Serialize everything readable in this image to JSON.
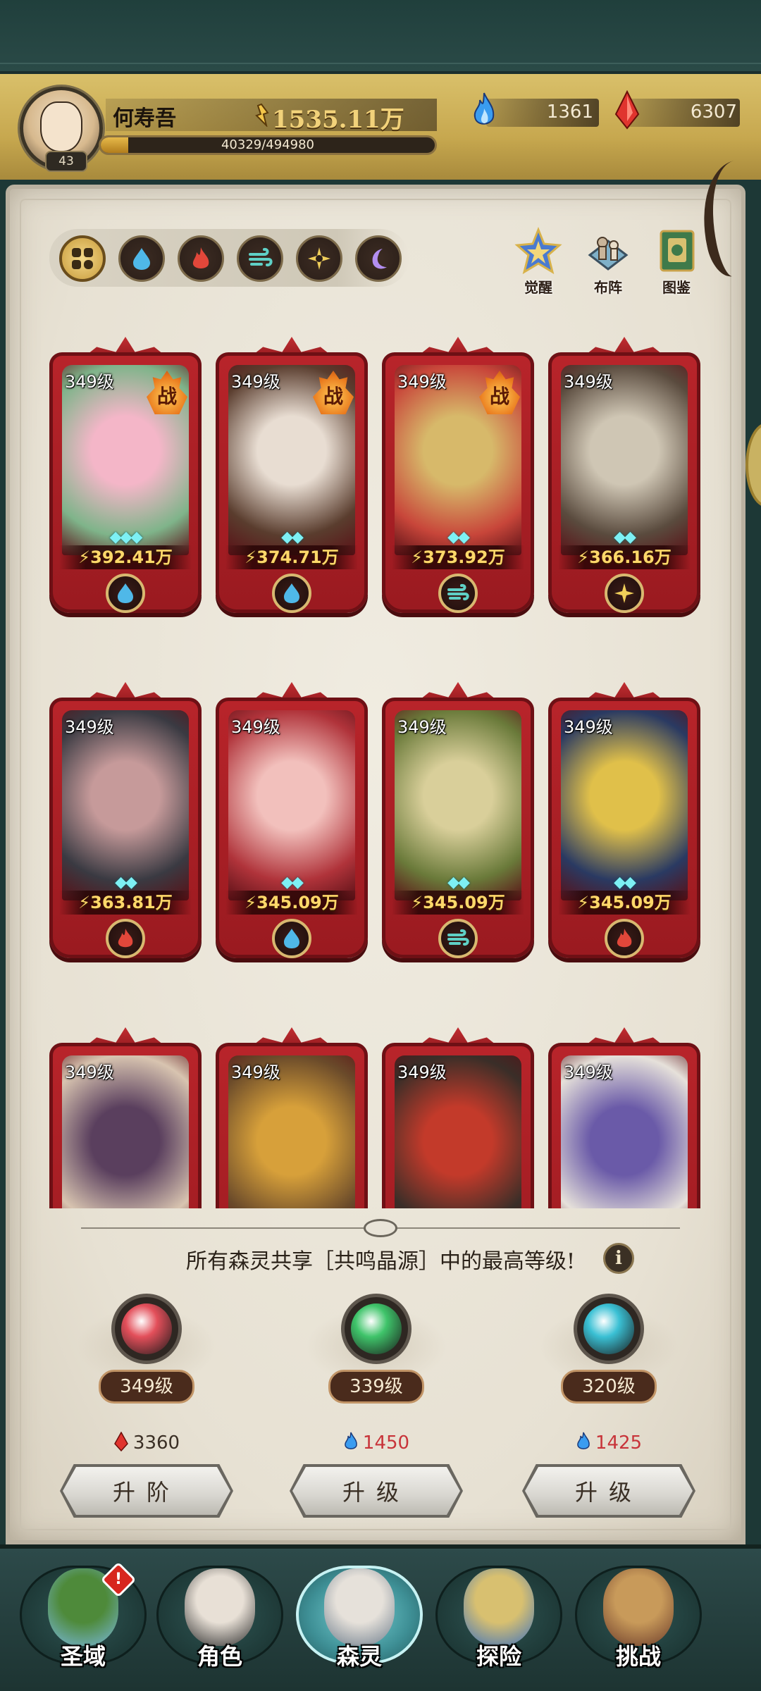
{
  "header": {
    "player_name": "何寿吾",
    "player_level": "43",
    "gold": "1535.11万",
    "exp_text": "40329/494980",
    "exp_fraction": 0.0815,
    "blue_resource": "1361",
    "red_resource": "6307"
  },
  "filters": {
    "items": [
      {
        "name": "all",
        "icon": "grid-icon",
        "active": true
      },
      {
        "name": "water",
        "icon": "water-drop-icon",
        "active": false
      },
      {
        "name": "fire",
        "icon": "fire-icon",
        "active": false
      },
      {
        "name": "wind",
        "icon": "wind-icon",
        "active": false
      },
      {
        "name": "light",
        "icon": "sun-icon",
        "active": false
      },
      {
        "name": "dark",
        "icon": "moon-icon",
        "active": false
      }
    ]
  },
  "top_actions": {
    "awaken": "觉醒",
    "formation": "布阵",
    "codex": "图鉴"
  },
  "cards": [
    {
      "level": "349级",
      "power": "392.41万",
      "stars": "◆◆◆",
      "battle": true,
      "battle_label": "战",
      "element": "water",
      "colors": [
        "#f4b6c8",
        "#7fb48a"
      ]
    },
    {
      "level": "349级",
      "power": "374.71万",
      "stars": "◆◆",
      "battle": true,
      "battle_label": "战",
      "element": "water",
      "colors": [
        "#e8ddd2",
        "#5a3d2e"
      ]
    },
    {
      "level": "349级",
      "power": "373.92万",
      "stars": "◆◆",
      "battle": true,
      "battle_label": "战",
      "element": "wind",
      "colors": [
        "#d7b96a",
        "#c8463a"
      ]
    },
    {
      "level": "349级",
      "power": "366.16万",
      "stars": "◆◆",
      "battle": false,
      "battle_label": "",
      "element": "light",
      "colors": [
        "#cfc6b4",
        "#5a4b3e"
      ]
    },
    {
      "level": "349级",
      "power": "363.81万",
      "stars": "◆◆",
      "battle": false,
      "battle_label": "",
      "element": "fire",
      "colors": [
        "#c69a9a",
        "#3a3a42"
      ]
    },
    {
      "level": "349级",
      "power": "345.09万",
      "stars": "◆◆",
      "battle": false,
      "battle_label": "",
      "element": "water",
      "colors": [
        "#f2c0bc",
        "#b0333a"
      ]
    },
    {
      "level": "349级",
      "power": "345.09万",
      "stars": "◆◆",
      "battle": false,
      "battle_label": "",
      "element": "wind",
      "colors": [
        "#d9cf9a",
        "#6a7a3a"
      ]
    },
    {
      "level": "349级",
      "power": "345.09万",
      "stars": "◆◆",
      "battle": false,
      "battle_label": "",
      "element": "fire",
      "colors": [
        "#e0c04a",
        "#2a3a62"
      ]
    },
    {
      "level": "349级",
      "power": "",
      "stars": "",
      "battle": false,
      "battle_label": "",
      "element": "",
      "colors": [
        "#5a3f5e",
        "#d8c4b0"
      ]
    },
    {
      "level": "349级",
      "power": "",
      "stars": "",
      "battle": false,
      "battle_label": "",
      "element": "",
      "colors": [
        "#d7a03a",
        "#6a4a2a"
      ]
    },
    {
      "level": "349级",
      "power": "",
      "stars": "",
      "battle": false,
      "battle_label": "",
      "element": "",
      "colors": [
        "#c33a2a",
        "#3a2e28"
      ]
    },
    {
      "level": "349级",
      "power": "",
      "stars": "",
      "battle": false,
      "battle_label": "",
      "element": "",
      "colors": [
        "#6a5aa8",
        "#e6e1da"
      ]
    }
  ],
  "shared_notice": "所有森灵共享［共鸣晶源］中的最高等级!",
  "info_label": "i",
  "crystals": [
    {
      "level": "349级",
      "cost": "3360",
      "cost_icon": "red-crystal-icon",
      "cost_color": "#3a2f25",
      "button": "升阶",
      "orb": "#e34f5a"
    },
    {
      "level": "339级",
      "cost": "1450",
      "cost_icon": "blue-flame-icon",
      "cost_color": "#c8343a",
      "button": "升级",
      "orb": "#3fc46a"
    },
    {
      "level": "320级",
      "cost": "1425",
      "cost_icon": "blue-flame-icon",
      "cost_color": "#c8343a",
      "button": "升级",
      "orb": "#3ac0d4"
    }
  ],
  "nav": {
    "items": [
      {
        "label": "圣域",
        "badge": "!",
        "active": false
      },
      {
        "label": "角色",
        "badge": "",
        "active": false
      },
      {
        "label": "森灵",
        "badge": "",
        "active": true
      },
      {
        "label": "探险",
        "badge": "",
        "active": false
      },
      {
        "label": "挑战",
        "badge": "",
        "active": false
      }
    ]
  }
}
